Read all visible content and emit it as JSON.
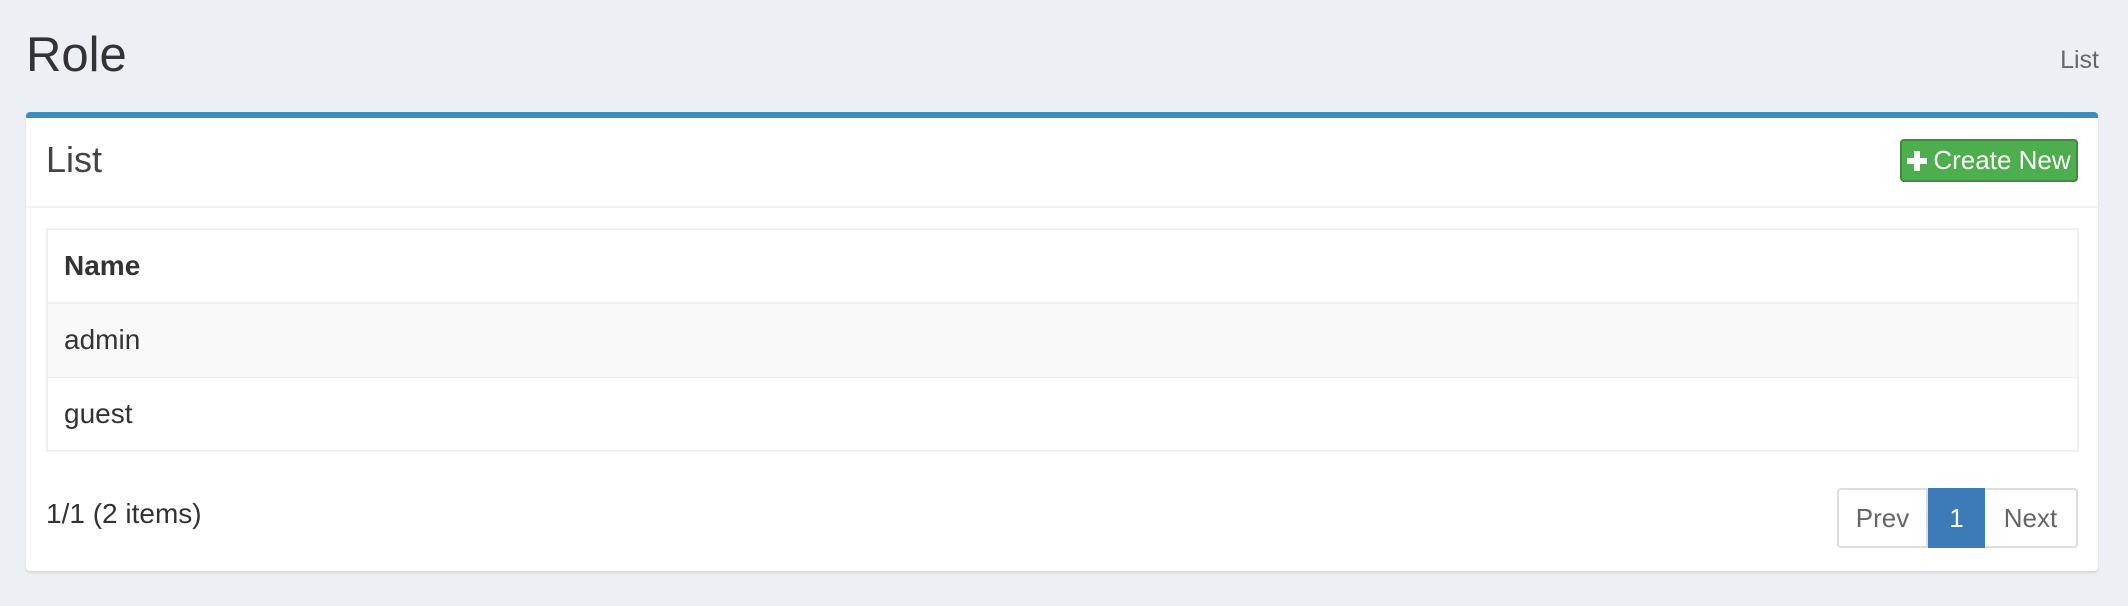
{
  "header": {
    "title": "Role",
    "breadcrumb": "List"
  },
  "box": {
    "title": "List",
    "create_button_label": "Create New",
    "create_button_icon": "plus-icon",
    "accent_color": "#3c8dbc",
    "create_button_color": "#4cae4c"
  },
  "table": {
    "columns": [
      "Name"
    ],
    "rows": [
      {
        "name": "admin"
      },
      {
        "name": "guest"
      }
    ]
  },
  "footer": {
    "info": "1/1 (2 items)",
    "prev_label": "Prev",
    "current_page": "1",
    "next_label": "Next"
  }
}
